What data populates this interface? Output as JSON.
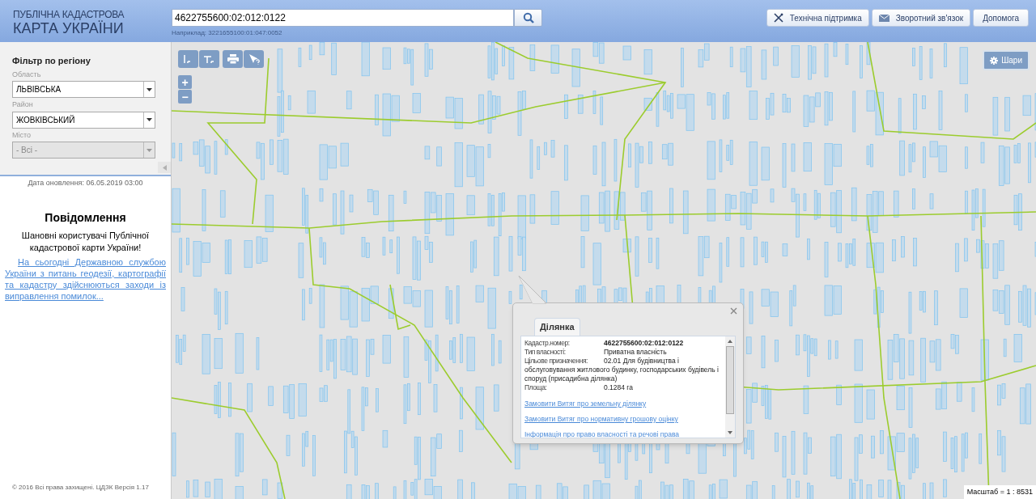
{
  "header": {
    "logo_line_1": "ПУБЛІЧНА КАДАСТРОВА",
    "logo_line_2": "КАРТА УКРАЇНИ",
    "search": {
      "value": "4622755600:02:012:0122",
      "hint": "Наприклад: 3221655100:01:047:0052"
    },
    "buttons": [
      {
        "kind": "support",
        "label": "Технічна підтримка"
      },
      {
        "kind": "feedback",
        "label": "Зворотний зв'язок"
      },
      {
        "kind": "plain",
        "label": "Допомога"
      }
    ]
  },
  "sidebar": {
    "filter_title": "Фільтр по регіону",
    "fields": [
      {
        "label": "Область",
        "value": "ЛЬВІВСЬКА",
        "disabled": false
      },
      {
        "label": "Район",
        "value": "ЖОВКІВСЬКИЙ",
        "disabled": false
      },
      {
        "label": "Місто",
        "value": "- Всі -",
        "disabled": true
      }
    ],
    "update_date": "Дата оновлення: 06.05.2019 03:00",
    "notice_title": "Повідомлення",
    "notice_greeting": "Шановні користувачі Публічної кадастрової карти України!",
    "notice_link": "На сьогодні Державною службою України з питань геодезії, картографії та кадастру здійснюються заходи із виправлення помилок...",
    "copyright": "© 2016 Всі права захищені. ЦДЗК Версія 1.17"
  },
  "map": {
    "zoom_in": "+",
    "zoom_out": "−",
    "layers_button": "Шари",
    "scale": "Масштаб = 1 : 8531",
    "popup": {
      "tab": "Ділянка",
      "fields": [
        {
          "label": "Кадастр.номер:",
          "value": "4622755600:02:012:0122",
          "bold": true
        },
        {
          "label": "Тип власності:",
          "value": "Приватна власність",
          "bold": false
        },
        {
          "label": "Цільове призначення:",
          "value": "02.01 Для будівництва і обслуговування житлового будинку, господарських будівель і споруд (присадибна ділянка)",
          "bold": false
        },
        {
          "label": "Площа:",
          "value": "0.1284 га",
          "bold": false
        }
      ],
      "links": [
        "Замовити Витяг про земельну ділянку",
        "Замовити Витяг про нормативну грошову оцінку",
        "Інформація про право власності та речові права"
      ]
    }
  }
}
